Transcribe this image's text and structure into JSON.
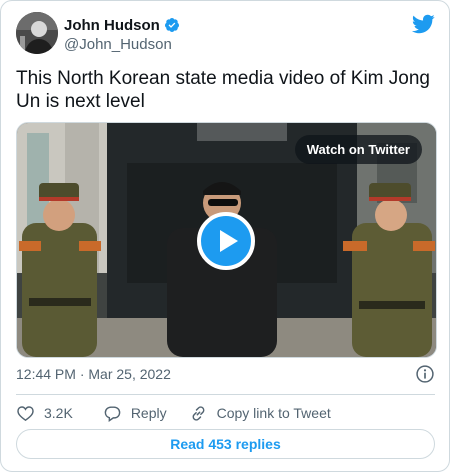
{
  "author": {
    "display_name": "John Hudson",
    "handle": "@John_Hudson"
  },
  "tweet": {
    "text": "This North Korean state media video of Kim Jong Un is next level"
  },
  "media": {
    "watch_label": "Watch on Twitter"
  },
  "meta": {
    "timestamp": "12:44 PM · Mar 25, 2022"
  },
  "actions": {
    "likes": "3.2K",
    "reply": "Reply",
    "copy_link": "Copy link to Tweet"
  },
  "replies_button": "Read 453 replies",
  "colors": {
    "accent": "#1d9bf0",
    "secondary_text": "#536471",
    "border": "#cfd9de",
    "like_icon": "#536471"
  },
  "icons": {
    "verified": "verified-badge-icon",
    "brand": "twitter-bird-icon",
    "play": "play-icon",
    "info": "info-icon",
    "like": "heart-icon",
    "reply": "speech-bubble-icon",
    "copy": "link-icon"
  }
}
